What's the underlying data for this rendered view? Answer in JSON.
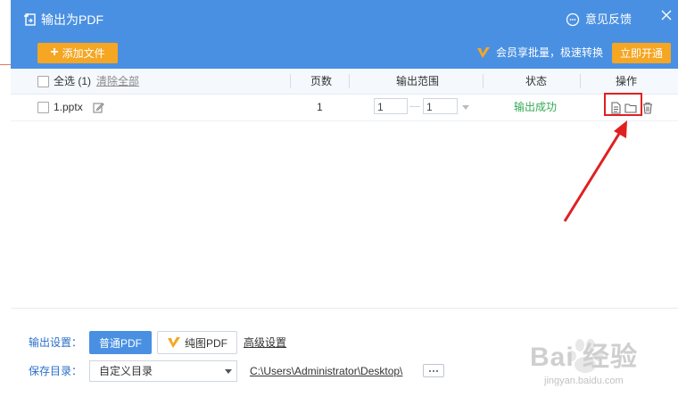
{
  "window": {
    "title": "输出为PDF",
    "feedback_label": "意见反馈",
    "close_icon": "close-icon"
  },
  "toolbar": {
    "add_file_label": "添加文件",
    "vip_text": "会员享批量，极速转换",
    "open_vip_label": "立即开通"
  },
  "table": {
    "select_all_label": "全选 (1)",
    "clear_all_label": "清除全部",
    "columns": {
      "pages": "页数",
      "range": "输出范围",
      "status": "状态",
      "actions": "操作"
    },
    "rows": [
      {
        "filename": "1.pptx",
        "pages": "1",
        "range_from": "1",
        "range_to": "1",
        "status": "输出成功"
      }
    ]
  },
  "settings": {
    "output_label": "输出设置：",
    "normal_pdf_label": "普通PDF",
    "image_pdf_label": "纯图PDF",
    "advanced_label": "高级设置",
    "save_dir_label": "保存目录：",
    "save_dir_option": "自定义目录",
    "save_path": "C:\\Users\\Administrator\\Desktop\\"
  },
  "watermark": {
    "text": "Bai 经验",
    "sub": "jingyan.baidu.com"
  },
  "colors": {
    "titlebar": "#4a90e2",
    "accent_orange": "#f5a623",
    "success_green": "#34a853",
    "annotation_red": "#e02020"
  }
}
